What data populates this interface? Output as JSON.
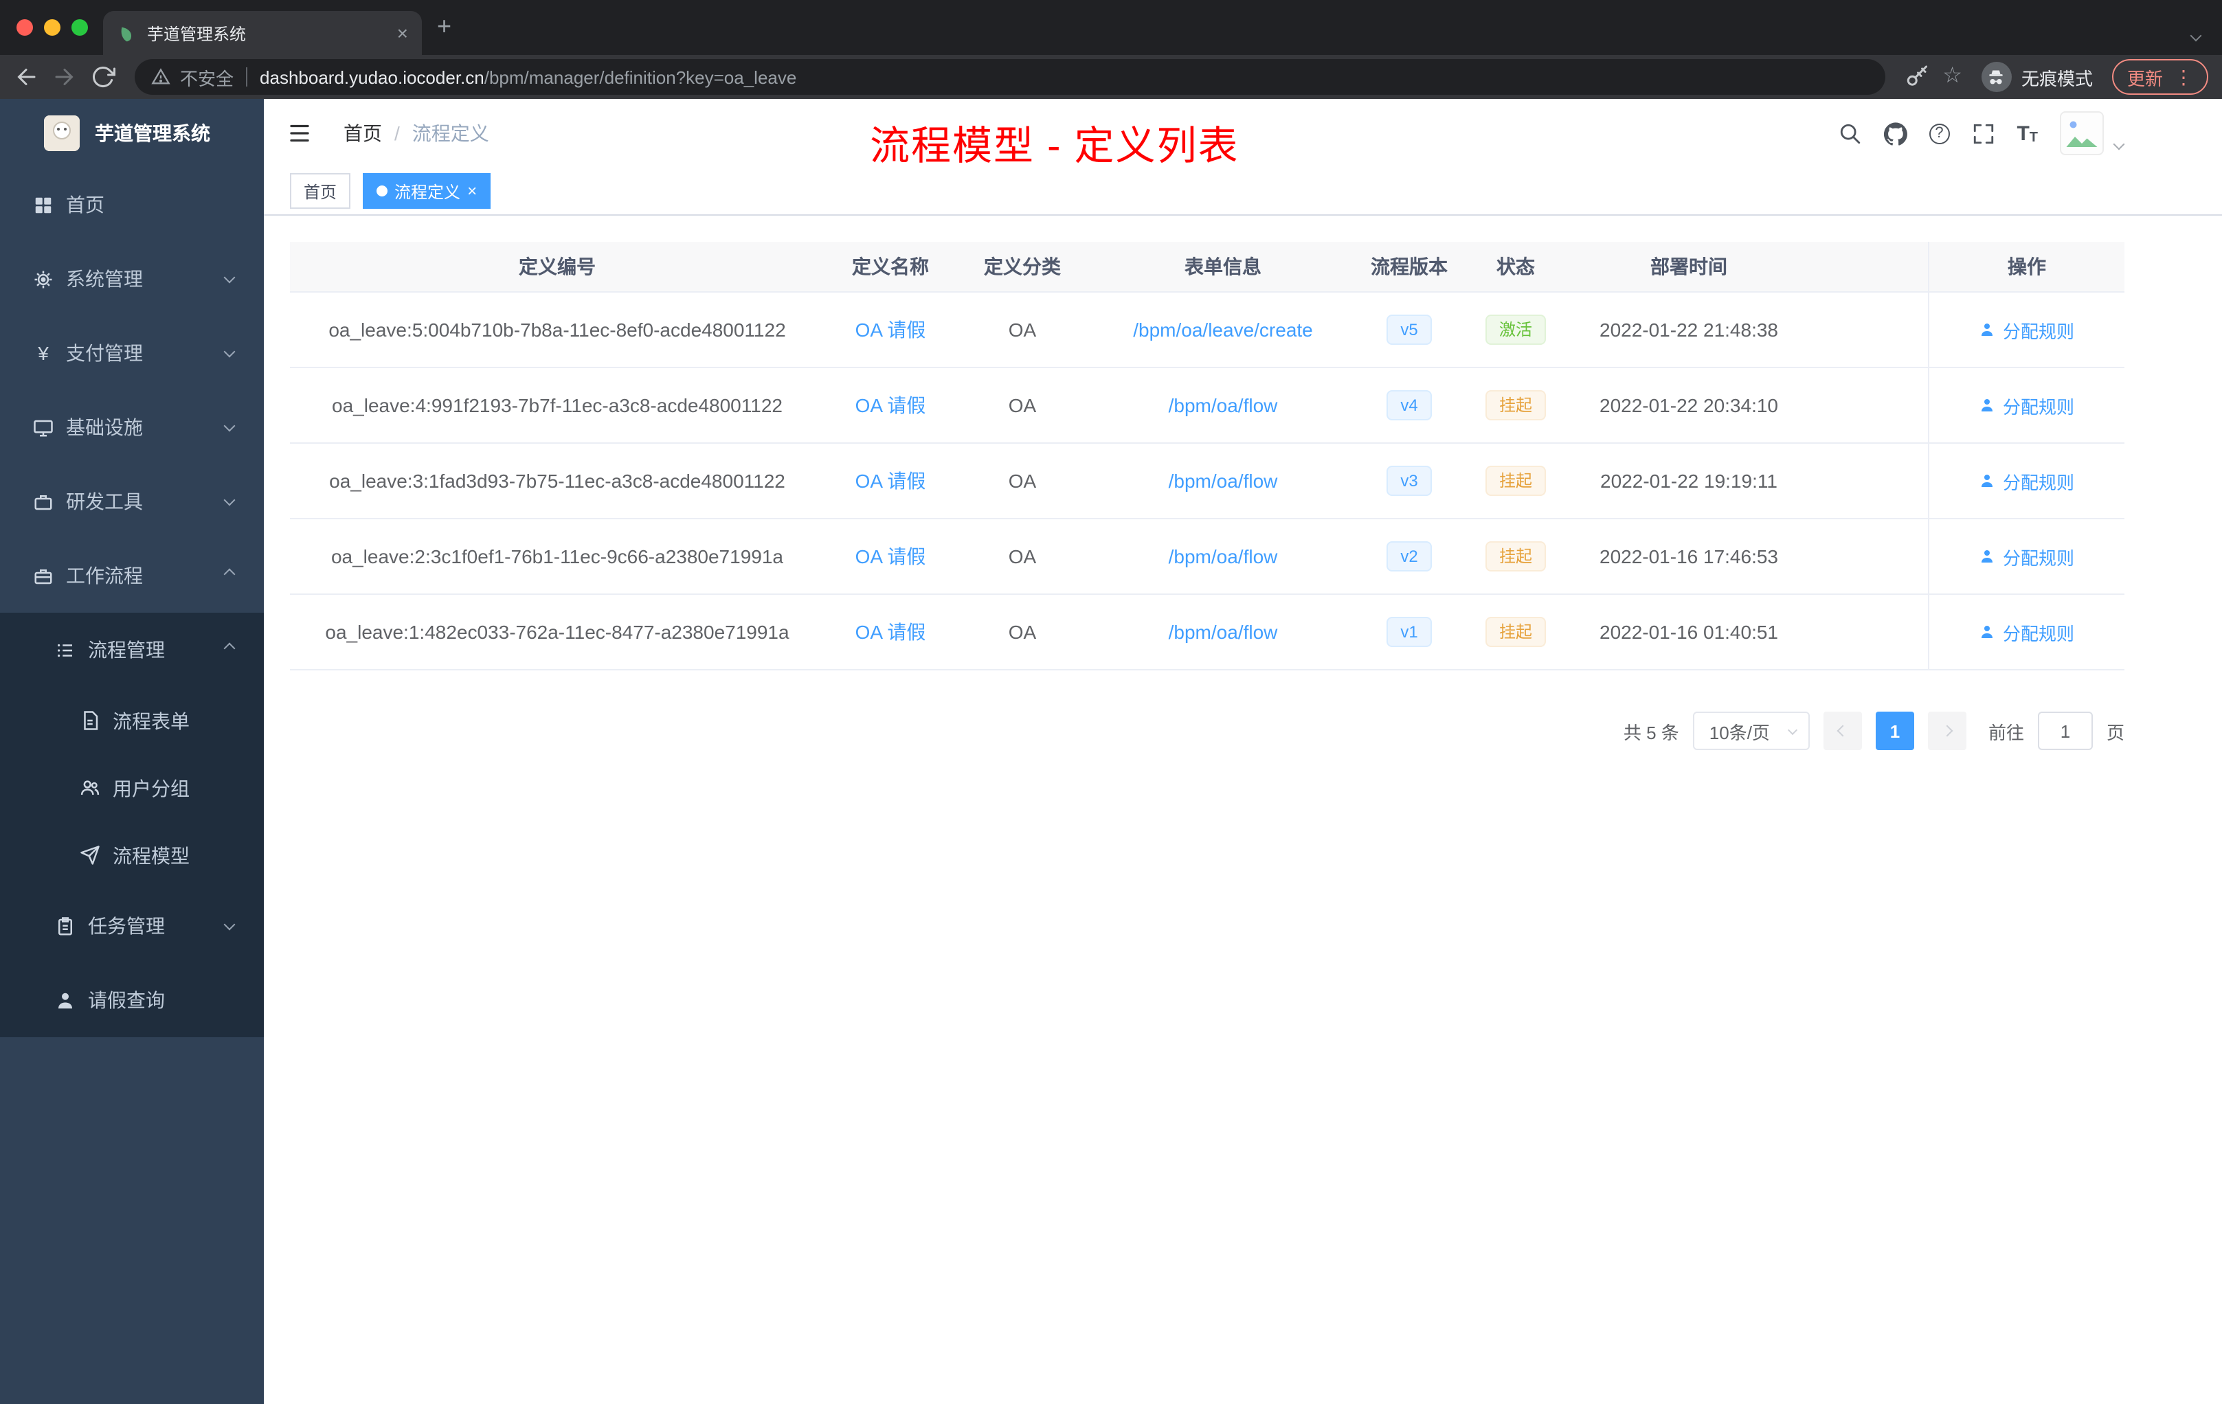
{
  "colors": {
    "accent": "#409eff",
    "success": "#67c23a",
    "warning": "#e6a23c",
    "annotation": "#ff0000",
    "sidebar_bg": "#304156",
    "submenu_bg": "#1f2d3d"
  },
  "glyphs": {
    "close_x": "×",
    "new_tab_plus": "+",
    "menu_dots": "⋮",
    "star": "☆",
    "question_mark": "?",
    "font_T_big": "T",
    "font_T_small": "T"
  },
  "browser": {
    "tab": {
      "title": "芋道管理系统"
    },
    "address": {
      "security_label": "不安全",
      "domain": "dashboard.yudao.iocoder.cn",
      "path": "/bpm/manager/definition?key=oa_leave"
    },
    "profile": {
      "label": "无痕模式"
    },
    "update": {
      "label": "更新"
    }
  },
  "sidebar": {
    "app_title": "芋道管理系统",
    "items": [
      {
        "label": "首页"
      },
      {
        "label": "系统管理"
      },
      {
        "label": "支付管理"
      },
      {
        "label": "基础设施"
      },
      {
        "label": "研发工具"
      },
      {
        "label": "工作流程"
      },
      {
        "label": "流程管理"
      },
      {
        "label": "流程表单"
      },
      {
        "label": "用户分组"
      },
      {
        "label": "流程模型"
      },
      {
        "label": "任务管理"
      },
      {
        "label": "请假查询"
      }
    ]
  },
  "header": {
    "breadcrumb": {
      "home": "首页",
      "separator": "/",
      "current": "流程定义"
    },
    "annotation": "流程模型 - 定义列表"
  },
  "tags": {
    "items": [
      {
        "label": "首页"
      },
      {
        "label": "流程定义"
      }
    ]
  },
  "table": {
    "columns": {
      "id": "定义编号",
      "name": "定义名称",
      "category": "定义分类",
      "form": "表单信息",
      "version": "流程版本",
      "status": "状态",
      "deploy_time": "部署时间",
      "actions": "操作"
    },
    "rows": [
      {
        "id": "oa_leave:5:004b710b-7b8a-11ec-8ef0-acde48001122",
        "name": "OA 请假",
        "category": "OA",
        "form": "/bpm/oa/leave/create",
        "version": "v5",
        "status": "激活",
        "status_class": "tag tag-success",
        "deploy_time": "2022-01-22 21:48:38",
        "action": "分配规则"
      },
      {
        "id": "oa_leave:4:991f2193-7b7f-11ec-a3c8-acde48001122",
        "name": "OA 请假",
        "category": "OA",
        "form": "/bpm/oa/flow",
        "version": "v4",
        "status": "挂起",
        "status_class": "tag tag-warning",
        "deploy_time": "2022-01-22 20:34:10",
        "action": "分配规则"
      },
      {
        "id": "oa_leave:3:1fad3d93-7b75-11ec-a3c8-acde48001122",
        "name": "OA 请假",
        "category": "OA",
        "form": "/bpm/oa/flow",
        "version": "v3",
        "status": "挂起",
        "status_class": "tag tag-warning",
        "deploy_time": "2022-01-22 19:19:11",
        "action": "分配规则"
      },
      {
        "id": "oa_leave:2:3c1f0ef1-76b1-11ec-9c66-a2380e71991a",
        "name": "OA 请假",
        "category": "OA",
        "form": "/bpm/oa/flow",
        "version": "v2",
        "status": "挂起",
        "status_class": "tag tag-warning",
        "deploy_time": "2022-01-16 17:46:53",
        "action": "分配规则"
      },
      {
        "id": "oa_leave:1:482ec033-762a-11ec-8477-a2380e71991a",
        "name": "OA 请假",
        "category": "OA",
        "form": "/bpm/oa/flow",
        "version": "v1",
        "status": "挂起",
        "status_class": "tag tag-warning",
        "deploy_time": "2022-01-16 01:40:51",
        "action": "分配规则"
      }
    ]
  },
  "pagination": {
    "total": "共 5 条",
    "page_size": "10条/页",
    "current_page": "1",
    "goto_label": "前往",
    "goto_value": "1",
    "page_label": "页"
  }
}
